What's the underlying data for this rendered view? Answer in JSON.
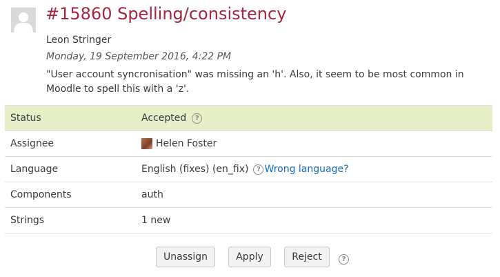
{
  "issue": {
    "title": "#15860 Spelling/consistency",
    "author": "Leon Stringer",
    "date": "Monday, 19 September 2016, 4:22 PM",
    "description": "\"User account syncronisation\" was missing an 'h'. Also, it seem to be most common in Moodle to spell this with a 'z'."
  },
  "details": {
    "status": {
      "label": "Status",
      "value": "Accepted"
    },
    "assignee": {
      "label": "Assignee",
      "value": "Helen Foster"
    },
    "language": {
      "label": "Language",
      "value": "English (fixes) (en_fix)",
      "link": "Wrong language?"
    },
    "components": {
      "label": "Components",
      "value": "auth"
    },
    "strings": {
      "label": "Strings",
      "value": "1 new"
    }
  },
  "actions": {
    "unassign": "Unassign",
    "apply": "Apply",
    "reject": "Reject"
  },
  "icons": {
    "help": "?"
  },
  "colors": {
    "title": "#a4263e",
    "status_row": "#e6efc7",
    "link": "#0f6cbf"
  }
}
